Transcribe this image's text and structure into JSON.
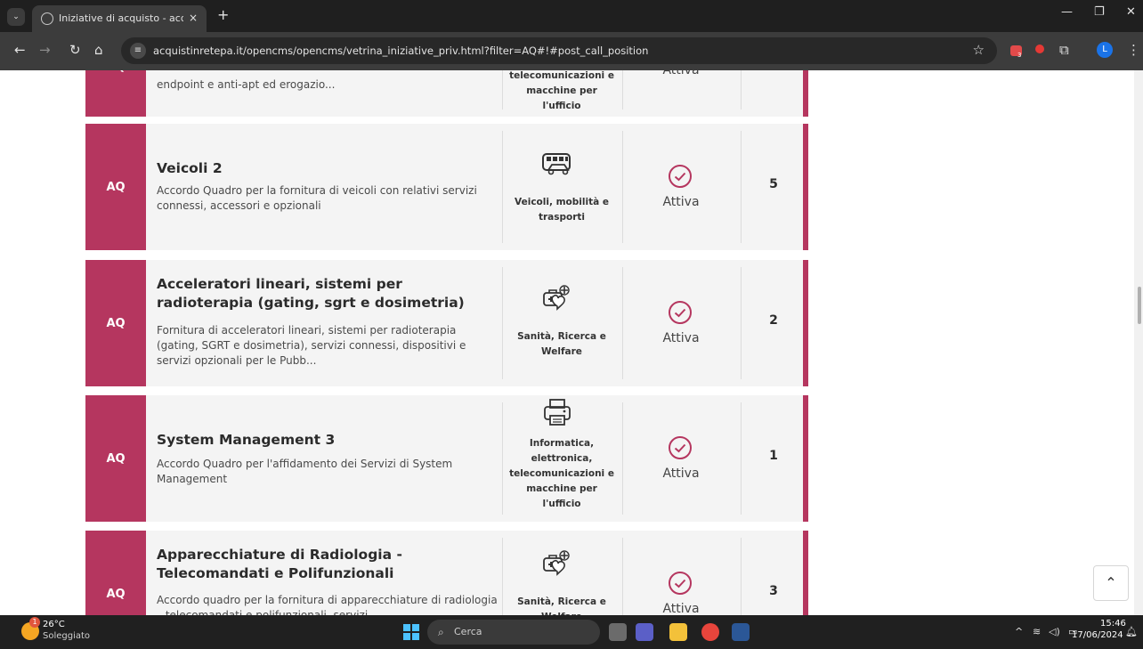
{
  "browser": {
    "tab_title": "Iniziative di acquisto - acquistin",
    "tab_close": "×",
    "new_tab": "+",
    "url": "acquistinretepa.it/opencms/opencms/vetrina_iniziative_priv.html?filter=AQ#!#post_call_position",
    "profile_initial": "L",
    "ext_badge": "3"
  },
  "cards": [
    {
      "badge": "AQ",
      "title": "",
      "desc": "endpoint e anti-apt ed erogazio...",
      "category": "telecomunicazioni e macchine per l'ufficio",
      "status": "Attiva",
      "count": "",
      "icon": "printer-icon"
    },
    {
      "badge": "AQ",
      "title": "Veicoli 2",
      "desc": "Accordo Quadro per la fornitura di veicoli con relativi servizi connessi, accessori e opzionali",
      "category": "Veicoli, mobilità e trasporti",
      "status": "Attiva",
      "count": "5",
      "icon": "vehicles-icon"
    },
    {
      "badge": "AQ",
      "title": "Acceleratori lineari, sistemi per radioterapia (gating, sgrt e dosimetria)",
      "desc": "Fornitura di acceleratori lineari, sistemi per radioterapia (gating, SGRT e dosimetria), servizi connessi, dispositivi e servizi opzionali per le Pubb...",
      "category": "Sanità, Ricerca e Welfare",
      "status": "Attiva",
      "count": "2",
      "icon": "health-icon"
    },
    {
      "badge": "AQ",
      "title": "System Management 3",
      "desc": "Accordo Quadro per l'affidamento dei Servizi di System Management",
      "category": "Informatica, elettronica, telecomunicazioni e macchine per l'ufficio",
      "status": "Attiva",
      "count": "1",
      "icon": "printer-icon"
    },
    {
      "badge": "AQ",
      "title": "Apparecchiature di Radiologia - Telecomandati e Polifunzionali",
      "desc": "Accordo quadro per la fornitura di apparecchiature di radiologia – telecomandati e polifunzionali, servizi...",
      "category": "Sanità, Ricerca e Welfare",
      "status": "Attiva",
      "count": "3",
      "icon": "health-icon"
    }
  ],
  "back_to_top": "⌃",
  "taskbar": {
    "temperature": "26°C",
    "condition": "Soleggiato",
    "weather_badge": "1",
    "search_label": "Cerca",
    "time": "15:46",
    "date": "17/06/2024"
  },
  "colors": {
    "accent": "#b5365f",
    "card_bg": "#f4f4f4"
  }
}
